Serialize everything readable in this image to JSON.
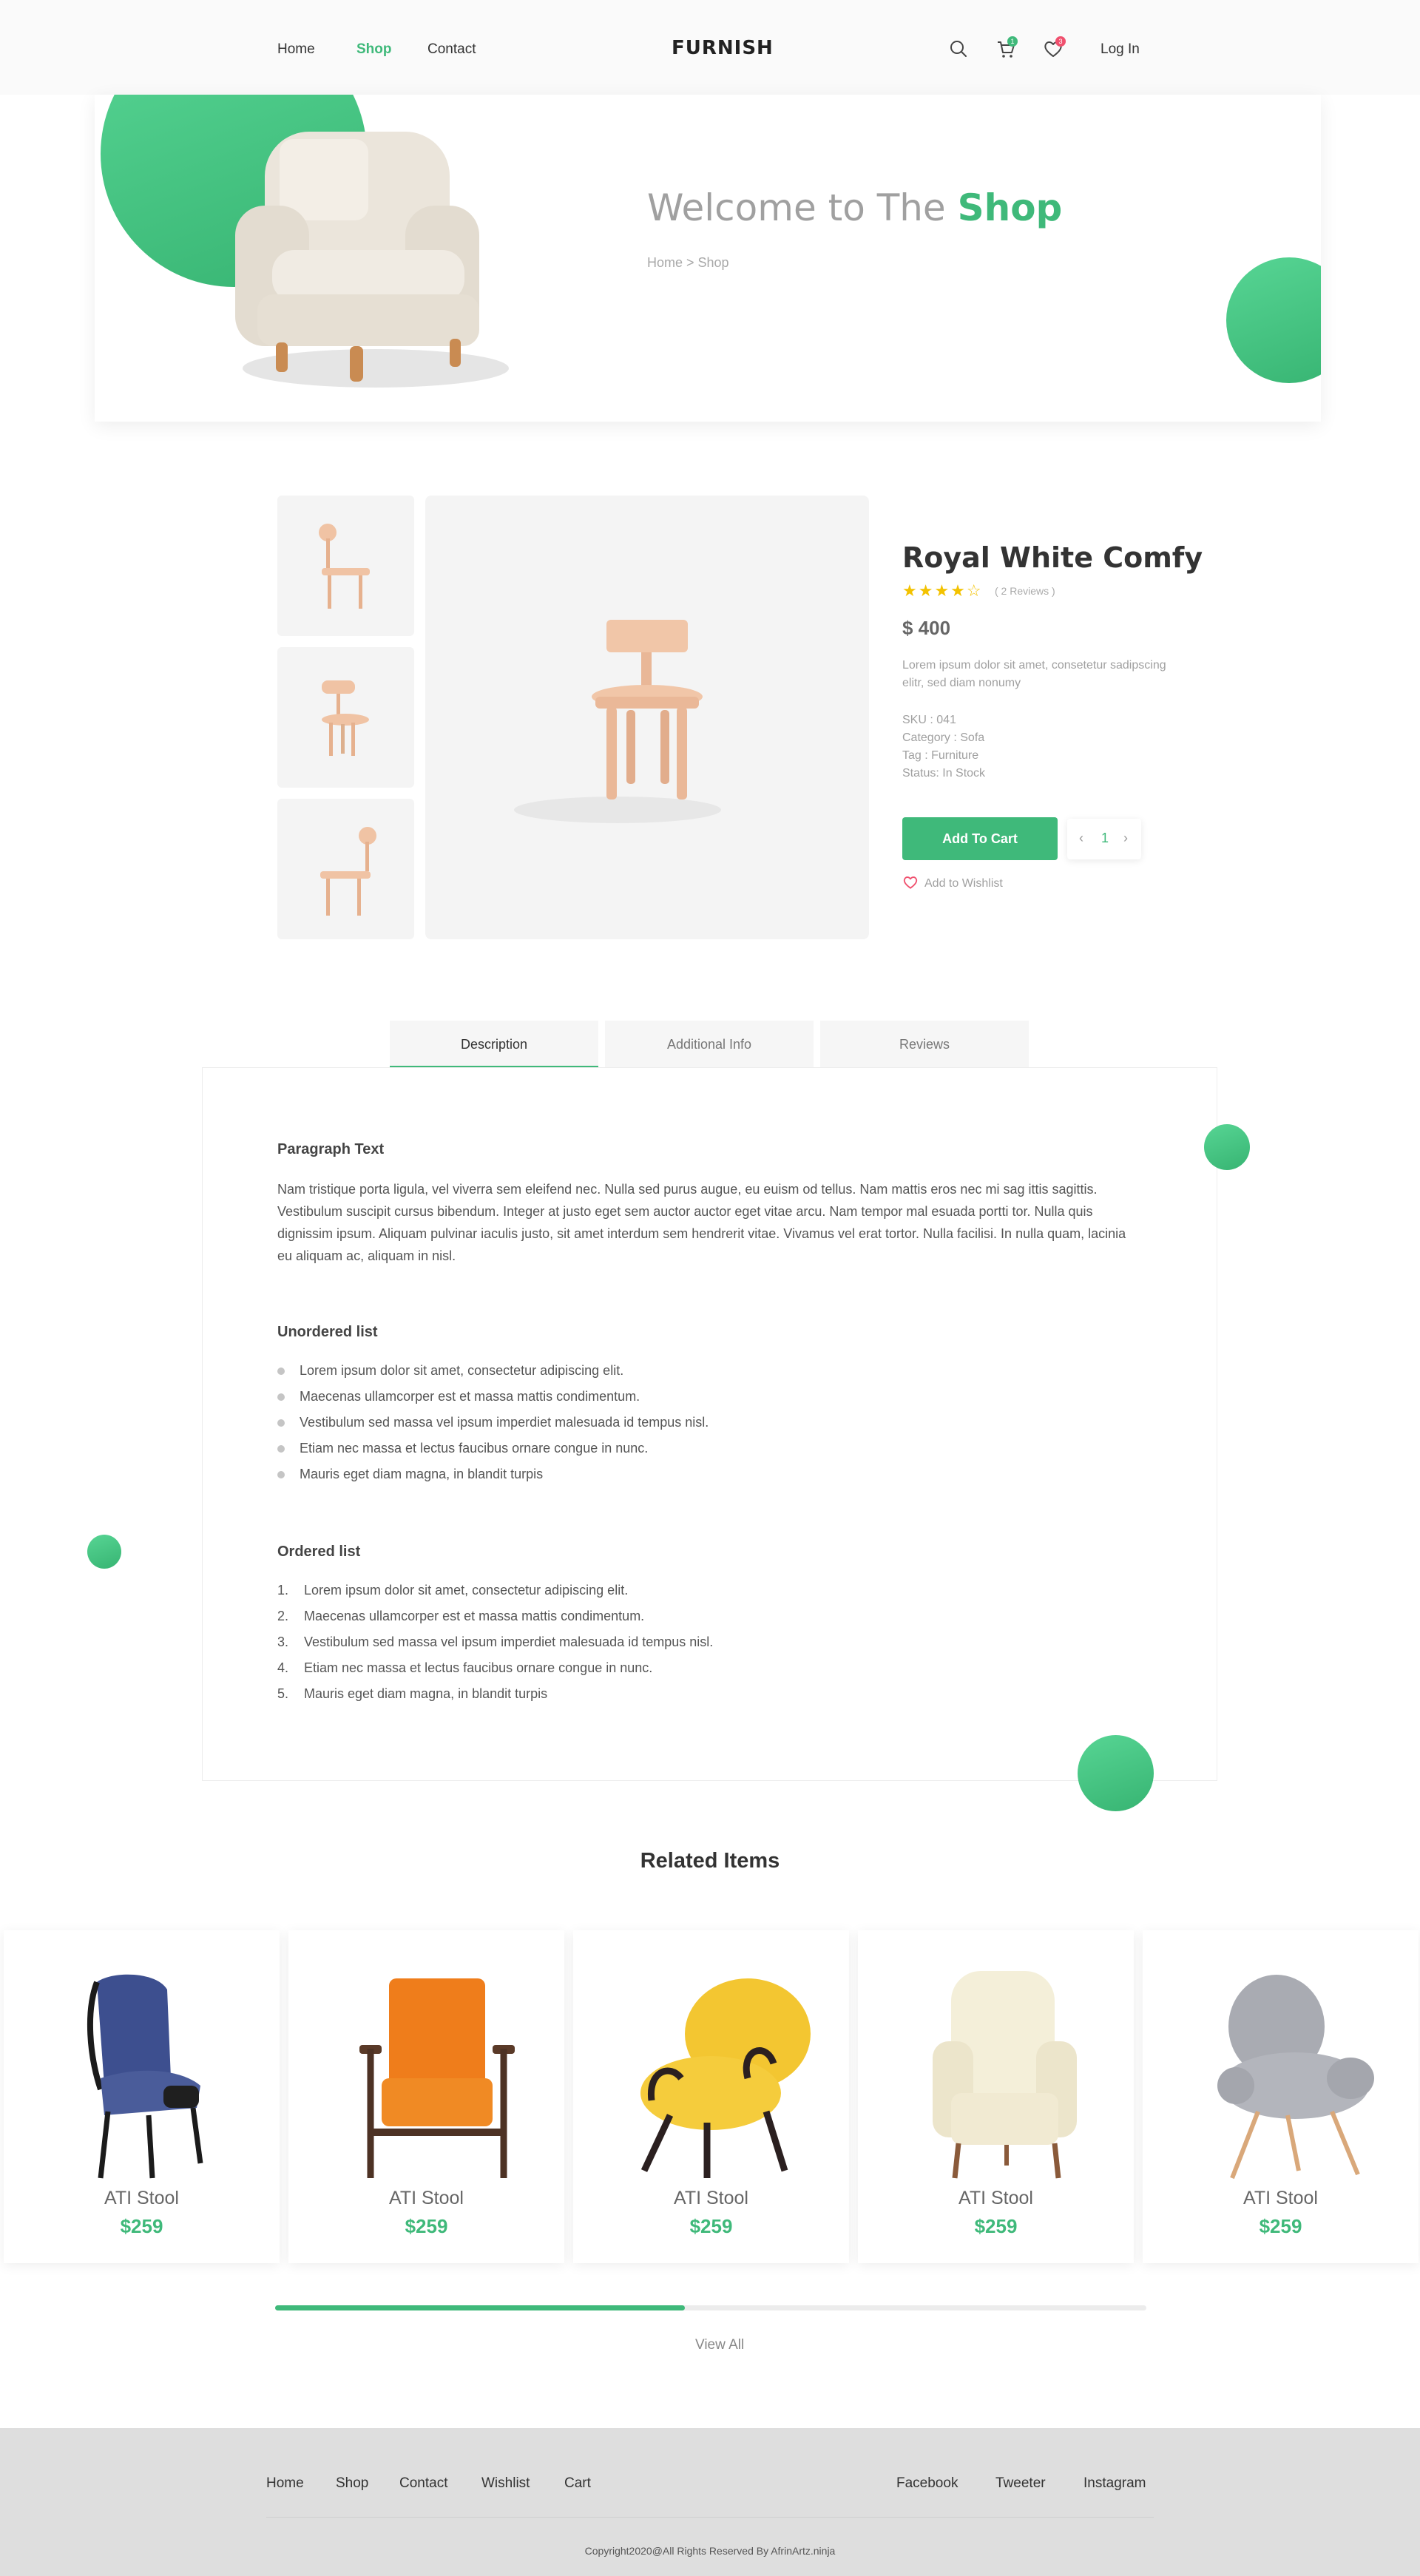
{
  "header": {
    "nav": [
      {
        "label": "Home"
      },
      {
        "label": "Shop"
      },
      {
        "label": "Contact"
      }
    ],
    "logo": "FURNISH",
    "cart_count": "1",
    "wishlist_count": "3",
    "login_label": "Log In"
  },
  "hero": {
    "title_prefix": "Welcome to The",
    "title_accent": "Shop",
    "breadcrumb": "Home > Shop"
  },
  "product": {
    "title": "Royal White Comfy",
    "stars": "★★★★☆",
    "rating": 4,
    "reviews": "( 2 Reviews )",
    "price": "$ 400",
    "description": "Lorem ipsum dolor sit amet, consetetur sadipscing elitr, sed diam nonumy",
    "sku": "SKU : 041",
    "category": "Category : Sofa",
    "tag": "Tag : Furniture",
    "status": "Status: In Stock",
    "add_to_cart": "Add To Cart",
    "quantity": "1",
    "add_to_wishlist": "Add to Wishlist"
  },
  "tabs": [
    {
      "label": "Description"
    },
    {
      "label": "Additional Info"
    },
    {
      "label": "Reviews"
    }
  ],
  "description": {
    "paragraph_heading": "Paragraph Text",
    "paragraph": "Nam tristique porta ligula, vel viverra sem eleifend nec. Nulla sed purus augue, eu euism od tellus. Nam mattis eros nec mi sag ittis sagittis. Vestibulum suscipit cursus bibendum. Integer at justo eget sem auctor auctor eget vitae arcu. Nam tempor mal esuada portti tor. Nulla quis dignissim ipsum. Aliquam pulvinar iaculis justo, sit amet interdum sem hendrerit vitae. Vivamus vel erat tortor. Nulla facilisi. In nulla quam, lacinia eu aliquam ac, aliquam in nisl.",
    "unordered_heading": "Unordered list",
    "unordered": [
      "Lorem ipsum dolor sit amet, consectetur adipiscing elit.",
      "Maecenas ullamcorper est et massa mattis condimentum.",
      "Vestibulum sed massa vel ipsum imperdiet malesuada id tempus nisl.",
      "Etiam nec massa et lectus faucibus ornare congue in nunc.",
      "Mauris eget diam magna, in blandit turpis"
    ],
    "ordered_heading": "Ordered list",
    "ordered": [
      {
        "num": "1.",
        "text": "Lorem ipsum dolor sit amet, consectetur adipiscing elit."
      },
      {
        "num": "2.",
        "text": "Maecenas ullamcorper est et massa mattis condimentum."
      },
      {
        "num": "3.",
        "text": "Vestibulum sed massa vel ipsum imperdiet malesuada id tempus nisl."
      },
      {
        "num": "4.",
        "text": "Etiam nec massa et lectus faucibus ornare congue in nunc."
      },
      {
        "num": "5.",
        "text": "Mauris eget diam magna, in blandit turpis"
      }
    ]
  },
  "related": {
    "title": "Related Items",
    "items": [
      {
        "name": "ATI Stool",
        "price": "$259"
      },
      {
        "name": "ATI Stool",
        "price": "$259"
      },
      {
        "name": "ATI Stool",
        "price": "$259"
      },
      {
        "name": "ATI Stool",
        "price": "$259"
      },
      {
        "name": "ATI Stool",
        "price": "$259"
      }
    ],
    "scroll_progress": 0.47,
    "view_all": "View All"
  },
  "footer": {
    "links": [
      {
        "label": "Home"
      },
      {
        "label": "Shop"
      },
      {
        "label": "Contact"
      },
      {
        "label": "Wishlist"
      },
      {
        "label": "Cart"
      }
    ],
    "social": [
      {
        "label": "Facebook"
      },
      {
        "label": "Tweeter"
      },
      {
        "label": "Instagram"
      }
    ],
    "copyright": "Copyright2020@All Rights Reserved By AfrinArtz.ninja"
  },
  "colors": {
    "accent": "#3fb97a",
    "star": "#f3c200",
    "badge_cart": "#3fb97a",
    "badge_wishlist": "#f0506e"
  }
}
